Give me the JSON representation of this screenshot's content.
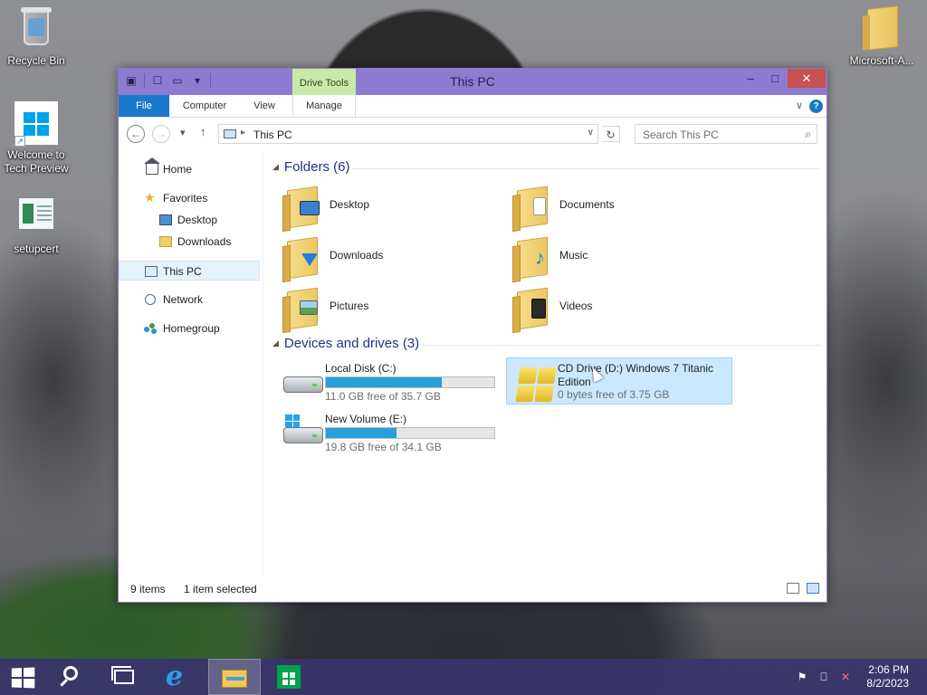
{
  "desktop": {
    "icons": [
      {
        "label": "Recycle Bin"
      },
      {
        "label": "Welcome to Tech Preview"
      },
      {
        "label": "setupcert"
      },
      {
        "label": "Microsoft-A..."
      }
    ]
  },
  "window": {
    "title": "This PC",
    "context_tab": "Drive Tools",
    "ribbon_tabs": [
      "File",
      "Computer",
      "View",
      "Manage"
    ],
    "caption_buttons": {
      "minimize": "–",
      "maximize": "□",
      "close": "✕"
    },
    "help": "?",
    "address": {
      "crumb": "This PC"
    },
    "search_placeholder": "Search This PC",
    "nav": [
      {
        "label": "Home",
        "icon": "home-icon"
      },
      {
        "label": "Favorites",
        "icon": "star-icon"
      },
      {
        "label": "Desktop",
        "icon": "desktop-icon"
      },
      {
        "label": "Downloads",
        "icon": "folder-icon"
      },
      {
        "label": "This PC",
        "icon": "computer-icon",
        "selected": true
      },
      {
        "label": "Network",
        "icon": "network-icon"
      },
      {
        "label": "Homegroup",
        "icon": "homegroup-icon"
      }
    ],
    "folders_header": "Folders (6)",
    "folders": [
      "Desktop",
      "Documents",
      "Downloads",
      "Music",
      "Pictures",
      "Videos"
    ],
    "devices_header": "Devices and drives (3)",
    "drives": [
      {
        "name": "Local Disk (C:)",
        "free": "11.0 GB free of 35.7 GB",
        "used_fraction": 0.69
      },
      {
        "name": "CD Drive (D:) Windows 7 Titanic Edition",
        "free": "0 bytes free of 3.75 GB",
        "selected": true
      },
      {
        "name": "New Volume (E:)",
        "free": "19.8 GB free of 34.1 GB",
        "used_fraction": 0.42
      }
    ],
    "status": {
      "items": "9 items",
      "selected": "1 item selected"
    }
  },
  "taskbar": {
    "clock_time": "2:06 PM",
    "clock_date": "8/2/2023",
    "active_app": "file-explorer"
  },
  "colors": {
    "titlebar": "#8c7bd0",
    "file_tab": "#1979ca",
    "drive_tools": "#c9e9a9",
    "bar_fill": "#26a0da",
    "taskbar": "#3a346c"
  }
}
